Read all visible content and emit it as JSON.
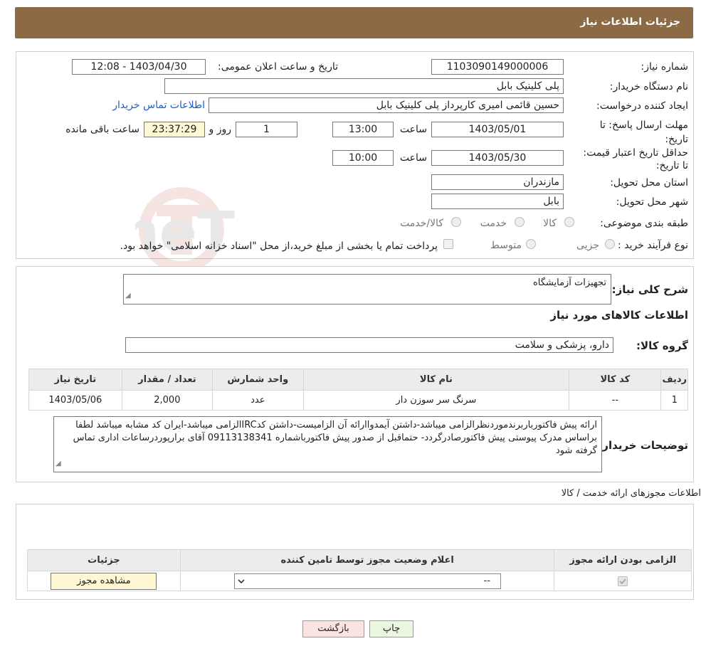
{
  "header": {
    "title": "جزئیات اطلاعات نیاز"
  },
  "form": {
    "need_number_label": "شماره نیاز:",
    "need_number": "1103090149000006",
    "announce_label": "تاریخ و ساعت اعلان عمومی:",
    "announce_value": "1403/04/30 - 12:08",
    "buyer_org_label": "نام دستگاه خریدار:",
    "buyer_org": "پلی کلینیک بابل",
    "creator_label": "ایجاد کننده درخواست:",
    "creator": "حسین قائمی امیری کارپرداز پلی کلینیک بابل",
    "contact_link": "اطلاعات تماس خریدار",
    "deadline_label": "مهلت ارسال پاسخ: تا تاریخ:",
    "deadline_date": "1403/05/01",
    "time_label": "ساعت",
    "deadline_time": "13:00",
    "days_value": "1",
    "days_label": "روز و",
    "remaining_time": "23:37:29",
    "remaining_label": "ساعت باقی مانده",
    "validity_label": "حداقل تاریخ اعتبار قیمت: تا تاریخ:",
    "validity_date": "1403/05/30",
    "validity_time": "10:00",
    "province_label": "استان محل تحویل:",
    "province": "مازندران",
    "city_label": "شهر محل تحویل:",
    "city": "بابل",
    "category_label": "طبقه بندی موضوعی:",
    "category_options": [
      "کالا",
      "خدمت",
      "کالا/خدمت"
    ],
    "process_label": "نوع فرآیند خرید :",
    "process_options": [
      "جزیی",
      "متوسط"
    ],
    "payment_note": "پرداخت تمام یا بخشی از مبلغ خرید،از محل \"اسناد خزانه اسلامی\" خواهد بود."
  },
  "need": {
    "summary_label": "شرح کلی نیاز:",
    "summary": "تجهیزات آزمایشگاه",
    "goods_title": "اطلاعات کالاهای مورد نیاز",
    "group_label": "گروه کالا:",
    "group": "دارو، پزشکی و سلامت"
  },
  "goods_table": {
    "headers": [
      "ردیف",
      "کد کالا",
      "نام کالا",
      "واحد شمارش",
      "تعداد / مقدار",
      "تاریخ نیاز"
    ],
    "rows": [
      [
        "1",
        "--",
        "سرنگ سر سوزن دار",
        "عدد",
        "2,000",
        "1403/05/06"
      ]
    ]
  },
  "buyer_notes": {
    "label": "توضیحات خریدار:",
    "text": "ارائه پیش فاکتورباربرندموردنظرالزامی میباشد-داشتن آیمدواارائه آن الزامیست-داشتن کدIRCالزامی میباشد-ایران کد مشابه میباشد لطفا براساس مدرک پیوستی پیش فاکتورصادرگردد- حتماقبل از صدور پیش فاکتورباشماره 09113138341 آقای برارپوردرساعات اداری تماس گرفته شود"
  },
  "permits": {
    "section_title": "اطلاعات مجوزهای ارائه خدمت / کالا",
    "headers": [
      "الزامی بودن ارائه مجوز",
      "اعلام وضعیت مجوز توسط تامین کننده",
      "جزئیات"
    ],
    "select_value": "--",
    "view_button": "مشاهده مجوز"
  },
  "buttons": {
    "print": "چاپ",
    "back": "بازگشت"
  }
}
